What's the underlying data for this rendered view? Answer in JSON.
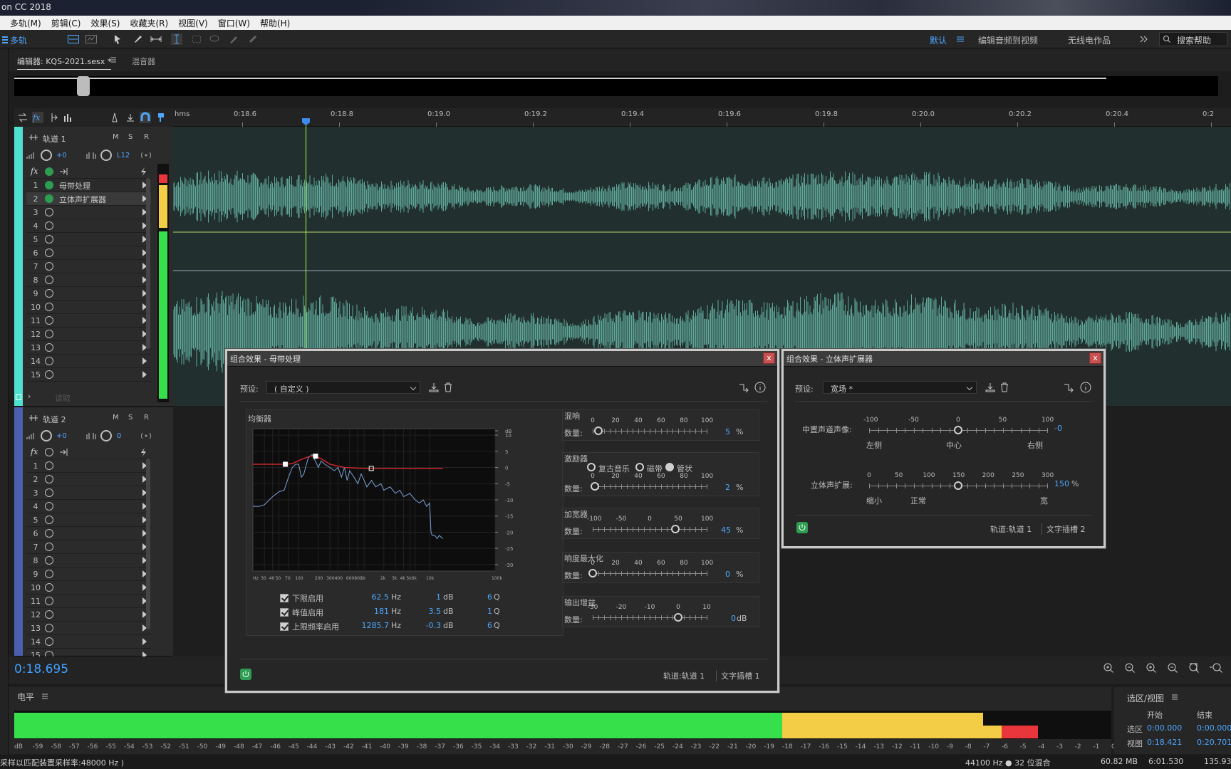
{
  "app": {
    "title": "on CC 2018"
  },
  "menu": [
    "多轨(M)",
    "剪辑(C)",
    "效果(S)",
    "收藏夹(R)",
    "视图(V)",
    "窗口(W)",
    "帮助(H)"
  ],
  "toolbar": {
    "mode_label": "多轨",
    "workspaces": [
      "默认",
      "编辑音频到视频",
      "无线电作品"
    ],
    "search_placeholder": "搜索帮助"
  },
  "editor": {
    "tab_label": "编辑器: KQS-2021.sesx *",
    "mixer_label": "混音器"
  },
  "ruler": {
    "unit": "hms",
    "ticks": [
      "0:18.6",
      "0:18.8",
      "0:19.0",
      "0:19.2",
      "0:19.4",
      "0:19.6",
      "0:19.8",
      "0:20.0",
      "0:20.2",
      "0:20.4",
      "0:2"
    ]
  },
  "tracks": [
    {
      "name": "轨道 1",
      "volume": "+0",
      "pan": "L12",
      "color": "#4fe0cf",
      "fx_slots": [
        {
          "n": "1",
          "name": "母带处理",
          "on": true
        },
        {
          "n": "2",
          "name": "立体声扩展器",
          "on": true
        },
        {
          "n": "3"
        },
        {
          "n": "4"
        },
        {
          "n": "5"
        },
        {
          "n": "6"
        },
        {
          "n": "7"
        },
        {
          "n": "8"
        },
        {
          "n": "9"
        },
        {
          "n": "10"
        },
        {
          "n": "11"
        },
        {
          "n": "12"
        },
        {
          "n": "13"
        },
        {
          "n": "14"
        },
        {
          "n": "15"
        }
      ],
      "send_label": "读取"
    },
    {
      "name": "轨道 2",
      "volume": "+0",
      "pan": "0",
      "color": "#4c5fae",
      "fx_slots": [
        {
          "n": "1"
        },
        {
          "n": "2"
        },
        {
          "n": "3"
        },
        {
          "n": "4"
        },
        {
          "n": "5"
        },
        {
          "n": "6"
        },
        {
          "n": "7"
        },
        {
          "n": "8"
        },
        {
          "n": "9"
        },
        {
          "n": "10"
        },
        {
          "n": "11"
        },
        {
          "n": "12"
        },
        {
          "n": "13"
        },
        {
          "n": "14"
        },
        {
          "n": "15"
        }
      ]
    }
  ],
  "msr": [
    "M",
    "S",
    "R"
  ],
  "playhead": {
    "time": "0:18.695"
  },
  "level": {
    "title": "电平",
    "scale": [
      "dB",
      "-59",
      "-58",
      "-57",
      "-56",
      "-55",
      "-54",
      "-53",
      "-52",
      "-51",
      "-50",
      "-49",
      "-48",
      "-47",
      "-46",
      "-45",
      "-44",
      "-43",
      "-42",
      "-41",
      "-40",
      "-39",
      "-38",
      "-37",
      "-36",
      "-35",
      "-34",
      "-33",
      "-32",
      "-31",
      "-30",
      "-29",
      "-28",
      "-27",
      "-26",
      "-25",
      "-24",
      "-23",
      "-22",
      "-21",
      "-20",
      "-19",
      "-18",
      "-17",
      "-16",
      "-15",
      "-14",
      "-13",
      "-12",
      "-11",
      "-10",
      "-9",
      "-8",
      "-7",
      "-6",
      "-5",
      "-4",
      "-3",
      "-2",
      "-1",
      "0"
    ],
    "left_peak_db": -7,
    "right_peak_db": -4,
    "colors": {
      "green": "#36e04b",
      "yellow": "#f2cd45",
      "red": "#e8363c"
    }
  },
  "selection": {
    "title": "选区/视图",
    "start_label": "开始",
    "end_label": "结束",
    "sel_label": "选区",
    "view_label": "视图",
    "sel_start": "0:00.000",
    "sel_end": "0:00.000",
    "view_start": "0:18.421",
    "view_end": "0:20.701"
  },
  "status": {
    "left": "采样以匹配装置采样率:48000 Hz )",
    "rate": "44100 Hz ● 32 位混合",
    "size": "60.82 MB",
    "duration": "6:01.530",
    "free": "135.93"
  },
  "mastering": {
    "title": "组合效果 - 母带处理",
    "close": "x",
    "preset_label": "预设:",
    "preset_value": "( 自定义 )",
    "eq_label": "均衡器",
    "eq_db_ticks": [
      "dB",
      "10",
      "5",
      "0",
      "-5",
      "-10",
      "-15",
      "-20",
      "-25",
      "-30"
    ],
    "eq_hz_ticks": [
      "Hz",
      "30",
      "40",
      "50",
      "70",
      "100",
      "200",
      "300",
      "400",
      "600",
      "800",
      "1k",
      "2k",
      "3k",
      "4k",
      "5k",
      "6k",
      "10k",
      "100k"
    ],
    "bands": [
      {
        "name": "下限启用",
        "hz": "62.5",
        "db": "1",
        "q": "6"
      },
      {
        "name": "峰值启用",
        "hz": "181",
        "db": "3.5",
        "q": "1"
      },
      {
        "name": "上限频率启用",
        "hz": "1285.7",
        "db": "-0.3",
        "q": "6"
      }
    ],
    "units": {
      "hz": "Hz",
      "db": "dB",
      "q": "Q"
    },
    "amount_label": "数量:",
    "reverb": {
      "label": "混响",
      "scale": [
        "0",
        "20",
        "40",
        "60",
        "80",
        "100"
      ],
      "value": "5",
      "unit": "%",
      "pos": 0.05
    },
    "exciter": {
      "label": "激励器",
      "modes": [
        "复古音乐",
        "磁带",
        "管状"
      ],
      "selected": 2,
      "scale": [
        "0",
        "20",
        "40",
        "60",
        "80",
        "100"
      ],
      "value": "2",
      "unit": "%",
      "pos": 0.02
    },
    "widener": {
      "label": "加宽器",
      "scale": [
        "-100",
        "-50",
        "0",
        "50",
        "100"
      ],
      "value": "45",
      "unit": "%",
      "pos": 0.725
    },
    "loudness": {
      "label": "响度最大化",
      "scale": [
        "0",
        "20",
        "40",
        "60",
        "80",
        "100"
      ],
      "value": "0",
      "unit": "%",
      "pos": 0.0
    },
    "output": {
      "label": "输出增益",
      "scale": [
        "-30",
        "-20",
        "-10",
        "0",
        "10"
      ],
      "value": "0",
      "unit": "dB",
      "pos": 0.75
    },
    "footer_track": "轨道:轨道 1",
    "footer_slot": "文字插槽 1"
  },
  "stereo": {
    "title": "组合效果 - 立体声扩展器",
    "close": "x",
    "preset_label": "预设:",
    "preset_value": "宽场 *",
    "center_label": "中置声道声像:",
    "center_scale": [
      "-100",
      "-50",
      "0",
      "50",
      "100"
    ],
    "center_value": "-0",
    "center_pos": 0.5,
    "center_marks": [
      "左侧",
      "中心",
      "右侧"
    ],
    "stereo_label": "立体声扩展:",
    "stereo_scale": [
      "0",
      "50",
      "100",
      "150",
      "200",
      "250",
      "300"
    ],
    "stereo_value": "150",
    "stereo_unit": "%",
    "stereo_pos": 0.5,
    "stereo_marks": [
      "缩小",
      "正常",
      "宽"
    ],
    "footer_track": "轨道:轨道 1",
    "footer_slot": "文字插槽 2"
  }
}
